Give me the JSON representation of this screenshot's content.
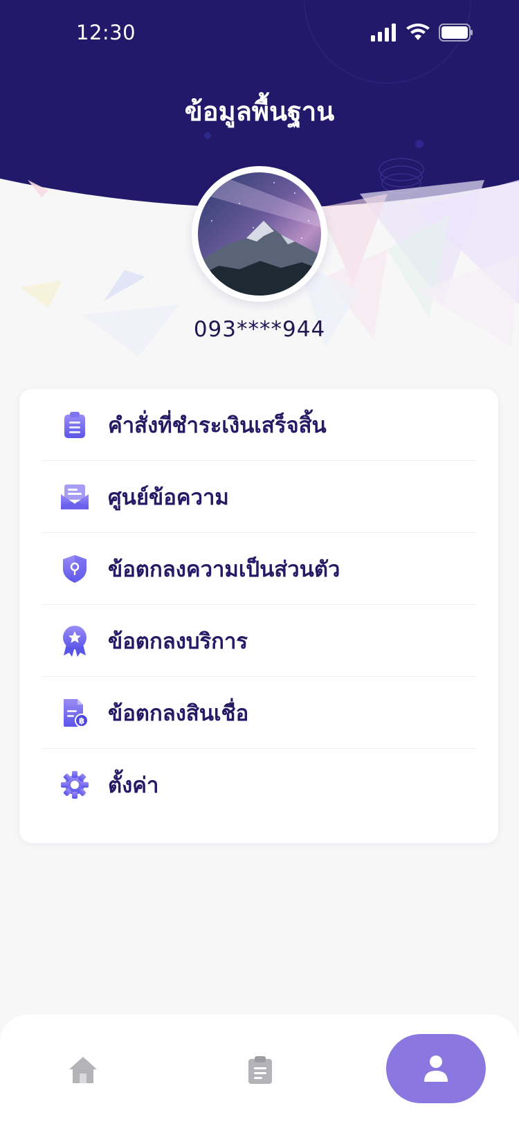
{
  "status_bar": {
    "time": "12:30"
  },
  "header": {
    "title": "ข้อมูลพื้นฐาน"
  },
  "profile": {
    "phone": "093****944"
  },
  "menu": {
    "items": [
      {
        "label": "คำสั่งที่ชำระเงินเสร็จสิ้น",
        "icon": "clipboard-icon"
      },
      {
        "label": "ศูนย์ข้อความ",
        "icon": "mail-icon"
      },
      {
        "label": "ข้อตกลงความเป็นส่วนตัว",
        "icon": "shield-icon"
      },
      {
        "label": "ข้อตกลงบริการ",
        "icon": "award-badge-icon"
      },
      {
        "label": "ข้อตกลงสินเชื่อ",
        "icon": "document-baht-icon"
      },
      {
        "label": "ตั้งค่า",
        "icon": "gear-icon"
      }
    ]
  },
  "bottom_nav": {
    "items": [
      {
        "icon": "home-icon",
        "active": false
      },
      {
        "icon": "clipboard-icon",
        "active": false
      },
      {
        "icon": "user-icon",
        "active": true
      }
    ]
  },
  "colors": {
    "header": "#22196a",
    "accent": "#8a78e0",
    "icon_gradient_start": "#9a8cf5",
    "icon_gradient_end": "#5b55e8",
    "text": "#241a66"
  }
}
